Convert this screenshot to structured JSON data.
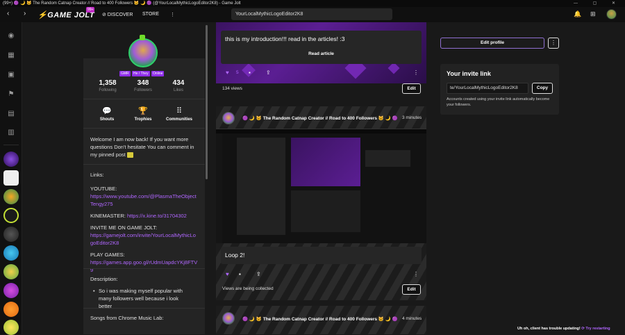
{
  "window": {
    "title": "(99+) 🟣 🌙 🐱 The Random Catnap Creator // Road to 400 Followers 🐱 🌙 🟣 (@YourLocalMythicLogoEditor2K8) - Game Jolt",
    "controls": "— ▢ ✕"
  },
  "nav": {
    "back": "‹",
    "forward": "›",
    "logo": "⚡GAME JOLT",
    "badge": "99+",
    "discover": "⊘ DISCOVER",
    "store": "STORE",
    "more": "⋮",
    "search_value": "YourLocalMythicLogoEditor2K8",
    "colors": {
      "accent": "#c02cc6",
      "link": "#b066ff"
    }
  },
  "profile": {
    "tags": [
      "GMR",
      "He / They",
      "Online"
    ],
    "stats": [
      {
        "value": "1,358",
        "label": "Following"
      },
      {
        "value": "348",
        "label": "Followers"
      },
      {
        "value": "434",
        "label": "Likes"
      }
    ],
    "quick": [
      "Shouts",
      "Trophies",
      "Communities"
    ],
    "bio_intro": "Welcome I am now back! If you want more questions Don't hesitate You can comment in my pinned post",
    "links_heading": "Links:",
    "youtube_label": "YOUTUBE:",
    "youtube_url": "https://www.youtube.com/@PlasmaTheObjectTengy275",
    "kinemaster_label": "KINEMASTER:",
    "kinemaster_url": "https://x.kine.to/31704302",
    "invite_label": "INVITE ME ON GAME JOLT:",
    "invite_url": "https://gamejolt.com/invite/YourLocalMythicLogoEditor2K8",
    "play_label": "PLAY GAMES:",
    "play_url": "https://games.app.goo.gl/rUdmUapdcYKj8FTV9",
    "description_heading": "Description:",
    "description_item": "So i was making myself popular with many followers well because i look better",
    "songs_heading": "Songs from Chrome Music Lab:"
  },
  "posts": [
    {
      "text": "this is my introduction!!! read in the articles! :3",
      "read_label": "Read article",
      "likes": "5",
      "views": "134 views",
      "edit_label": "Edit"
    },
    {
      "author": "🟣 🌙 🐱 The Random Catnap Creator // Road to 400 Followers 🐱 🌙 🟣",
      "time": "3 minutes",
      "text": "Loop 2!",
      "views": "Views are being collected",
      "edit_label": "Edit"
    },
    {
      "author": "🟣 🌙 🐱 The Random Catnap Creator // Road to 400 Followers 🐱 🌙 🟣",
      "time": "4 minutes"
    }
  ],
  "right": {
    "edit_profile": "Edit profile",
    "more": "⋮",
    "invite_heading": "Your invite link",
    "invite_value": "te/YourLocalMythicLogoEditor2K8",
    "copy_label": "Copy",
    "invite_note": "Accounts created using your invite link automatically become your followers."
  },
  "toast": {
    "message": "Uh oh, client has trouble updating!",
    "action": "⟳ Try restarting"
  }
}
